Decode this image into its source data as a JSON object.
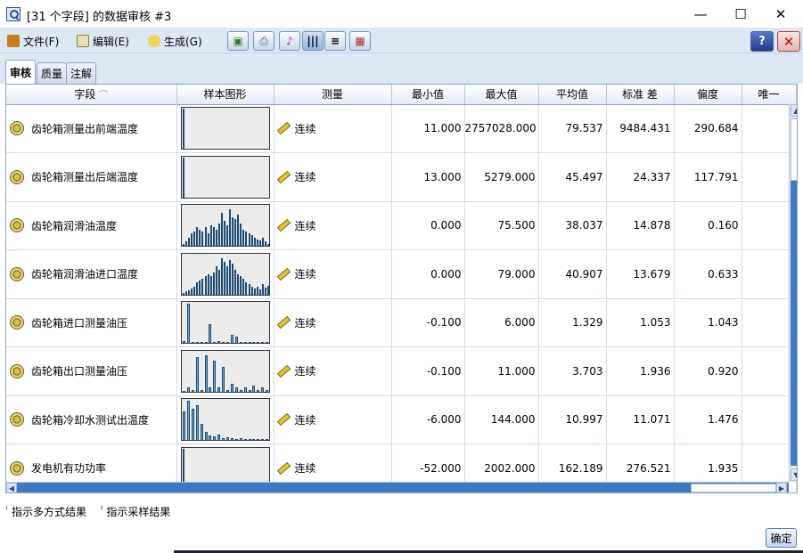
{
  "window": {
    "title": "[31 个字段] 的数据审核 #3",
    "minimize": "—",
    "maximize": "☐",
    "close": "✕"
  },
  "menu": {
    "file": "文件(F)",
    "edit": "编辑(E)",
    "generate": "生成(G)",
    "help": "?",
    "close": "✕"
  },
  "tabs": [
    "审核",
    "质量",
    "注解"
  ],
  "columns": {
    "field": "字段",
    "chart": "样本图形",
    "measure": "测量",
    "min": "最小值",
    "max": "最大值",
    "mean": "平均值",
    "std": "标准 差",
    "skew": "偏度",
    "unique": "唯一"
  },
  "rows": [
    {
      "field": "齿轮箱测量出前端温度",
      "measure": "连续",
      "min": "11.000",
      "max": "2757028.000",
      "mean": "79.537",
      "std": "9484.431",
      "skew": "290.684",
      "hist": [
        0.98
      ]
    },
    {
      "field": "齿轮箱测量出后端温度",
      "measure": "连续",
      "min": "13.000",
      "max": "5279.000",
      "mean": "45.497",
      "std": "24.337",
      "skew": "117.791",
      "hist": [
        0.98
      ]
    },
    {
      "field": "齿轮箱润滑油温度",
      "measure": "连续",
      "min": "0.000",
      "max": "75.500",
      "mean": "38.037",
      "std": "14.878",
      "skew": "0.160",
      "hist": [
        0.05,
        0.1,
        0.2,
        0.3,
        0.35,
        0.45,
        0.4,
        0.35,
        0.45,
        0.3,
        0.5,
        0.45,
        0.4,
        0.55,
        0.8,
        0.6,
        0.5,
        0.9,
        0.7,
        0.65,
        0.75,
        0.55,
        0.4,
        0.35,
        0.3,
        0.25,
        0.2,
        0.15,
        0.12,
        0.2,
        0.1,
        0.05
      ]
    },
    {
      "field": "齿轮箱润滑油进口温度",
      "measure": "连续",
      "min": "0.000",
      "max": "79.000",
      "mean": "40.907",
      "std": "13.679",
      "skew": "0.633",
      "hist": [
        0.05,
        0.08,
        0.1,
        0.15,
        0.2,
        0.3,
        0.35,
        0.4,
        0.45,
        0.5,
        0.45,
        0.55,
        0.7,
        0.6,
        0.9,
        0.8,
        0.7,
        0.85,
        0.75,
        0.6,
        0.5,
        0.45,
        0.4,
        0.3,
        0.25,
        0.2,
        0.15,
        0.2,
        0.12,
        0.25,
        0.18,
        0.22
      ]
    },
    {
      "field": "齿轮箱进口测量油压",
      "measure": "连续",
      "min": "-0.100",
      "max": "6.000",
      "mean": "1.329",
      "std": "1.053",
      "skew": "1.043",
      "hist": [
        0.05,
        0.95,
        0,
        0,
        0.02,
        0,
        0.45,
        0,
        0.05,
        0,
        0.03,
        0.2,
        0.15,
        0,
        0.02,
        0.03,
        0,
        0.02,
        0,
        0.01
      ]
    },
    {
      "field": "齿轮箱出口测量油压",
      "measure": "连续",
      "min": "-0.100",
      "max": "11.000",
      "mean": "3.703",
      "std": "1.936",
      "skew": "0.920",
      "hist": [
        0.03,
        0.1,
        0.05,
        0.85,
        0.05,
        0.9,
        0.1,
        0.75,
        0.1,
        0.6,
        0.05,
        0.2,
        0.1,
        0.05,
        0.1,
        0.05,
        0.15,
        0.05,
        0.1,
        0.05
      ]
    },
    {
      "field": "齿轮箱冷却水测试出温度",
      "measure": "连续",
      "min": "-6.000",
      "max": "144.000",
      "mean": "10.997",
      "std": "11.071",
      "skew": "1.476",
      "hist": [
        0.7,
        0.95,
        0.75,
        0.85,
        0.4,
        0.2,
        0.1,
        0.08,
        0.12,
        0.05,
        0.06,
        0.04,
        0.03,
        0.04,
        0.02,
        0,
        0,
        0,
        0,
        0
      ]
    },
    {
      "field": "发电机有功功率",
      "measure": "连续",
      "min": "-52.000",
      "max": "2002.000",
      "mean": "162.189",
      "std": "276.521",
      "skew": "1.935",
      "hist": [
        0.98
      ]
    }
  ],
  "footnote": {
    "multi_mark": "¹",
    "multi": "指示多方式结果",
    "sample_mark": "²",
    "sample": "指示采样结果"
  },
  "ok_button": "确定"
}
